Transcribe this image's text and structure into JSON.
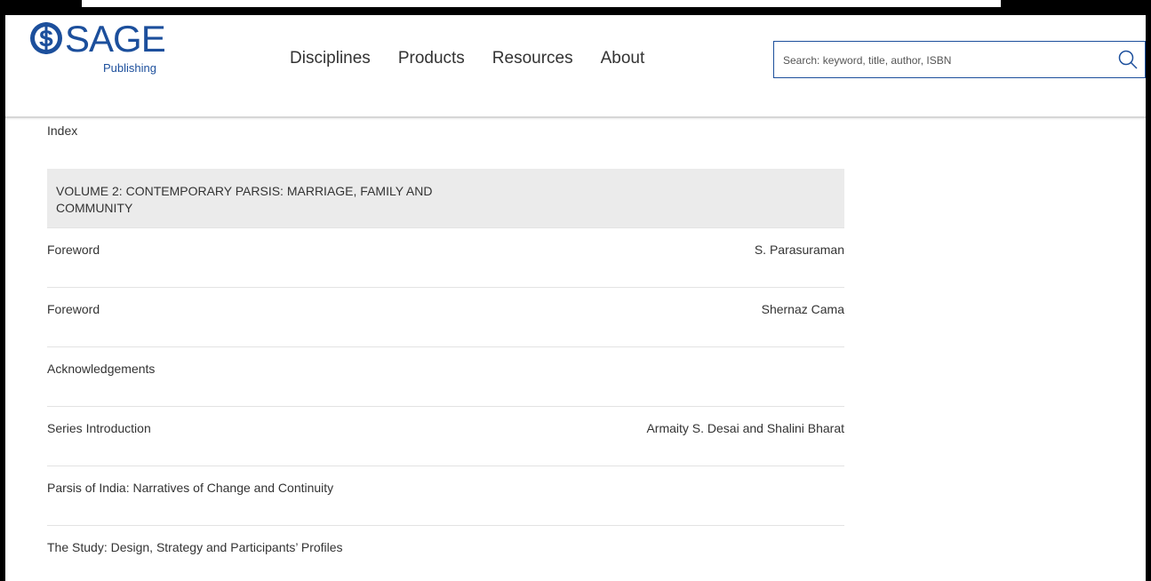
{
  "brand": {
    "name": "SAGE",
    "sub": "Publishing",
    "color": "#1c4f9c"
  },
  "nav": {
    "items": [
      "Disciplines",
      "Products",
      "Resources",
      "About"
    ]
  },
  "search": {
    "placeholder": "Search: keyword, title, author, ISBN",
    "icon": "search-icon"
  },
  "toc": {
    "index_label": "Index",
    "volume_heading": "VOLUME 2: CONTEMPORARY PARSIS: MARRIAGE, FAMILY AND COMMUNITY",
    "rows": [
      {
        "title": "Foreword",
        "author": "S. Parasuraman"
      },
      {
        "title": "Foreword",
        "author": "Shernaz Cama"
      },
      {
        "title": "Acknowledgements",
        "author": ""
      },
      {
        "title": "Series Introduction",
        "author": "Armaity S. Desai and Shalini Bharat"
      },
      {
        "title": "Parsis of India: Narratives of Change and Continuity",
        "author": ""
      },
      {
        "title": "The Study: Design, Strategy and Participants’ Profiles",
        "author": ""
      }
    ]
  }
}
